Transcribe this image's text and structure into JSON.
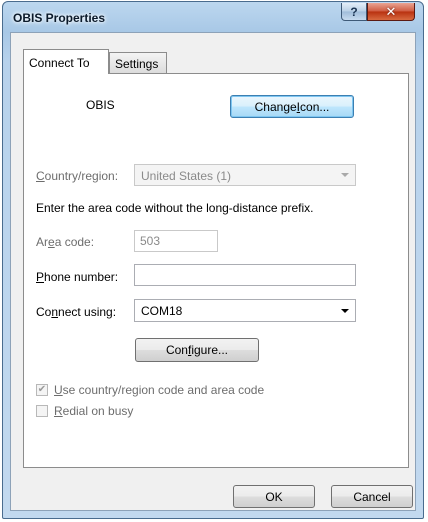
{
  "window": {
    "title": "OBIS Properties",
    "help_glyph": "?",
    "close_glyph": "✕"
  },
  "tabs": [
    {
      "label": "Connect To",
      "selected": true
    },
    {
      "label": "Settings",
      "selected": false
    }
  ],
  "connection": {
    "name": "OBIS",
    "change_icon_button": {
      "pre": "Change ",
      "key": "I",
      "post": "con..."
    }
  },
  "country": {
    "label": {
      "key": "C",
      "post": "ountry/region:"
    },
    "value": "United States (1)",
    "enabled": false
  },
  "instruction": "Enter the area code without the long-distance prefix.",
  "area_code": {
    "label": {
      "pre": "Ar",
      "key": "e",
      "post": "a code:"
    },
    "value": "503",
    "enabled": false
  },
  "phone_number": {
    "label": {
      "key": "P",
      "post": "hone number:"
    },
    "value": ""
  },
  "connect_using": {
    "label": {
      "pre": "Co",
      "key": "n",
      "post": "nect using:"
    },
    "value": "COM18"
  },
  "configure_button": {
    "pre": "Con",
    "key": "f",
    "post": "igure..."
  },
  "use_country_code": {
    "label": {
      "key": "U",
      "post": "se country/region code and area code"
    },
    "checked": true,
    "enabled": false
  },
  "redial_on_busy": {
    "label": {
      "key": "R",
      "post": "edial on busy"
    },
    "checked": false,
    "enabled": false
  },
  "footer": {
    "ok_label": "OK",
    "cancel_label": "Cancel"
  }
}
